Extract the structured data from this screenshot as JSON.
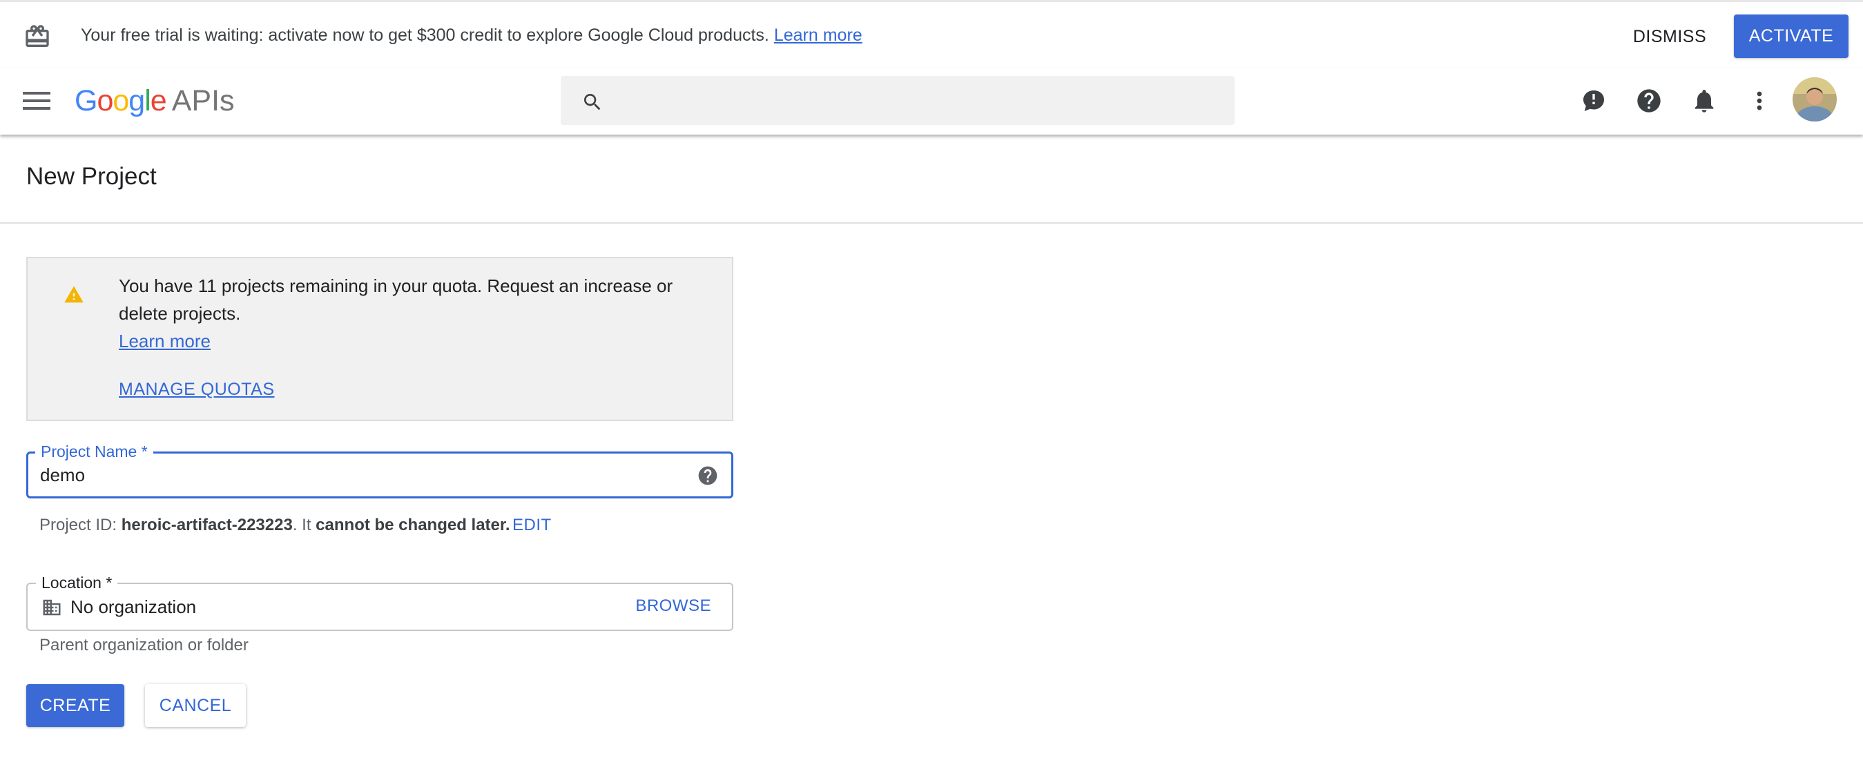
{
  "trial_banner": {
    "message": "Your free trial is waiting: activate now to get $300 credit to explore Google Cloud products.",
    "learn_more": "Learn more",
    "dismiss_label": "DISMISS",
    "activate_label": "ACTIVATE",
    "icon": "gift-icon"
  },
  "header": {
    "logo_letters": [
      "G",
      "o",
      "o",
      "g",
      "l",
      "e"
    ],
    "logo_suffix": "APIs",
    "search_placeholder": "",
    "icons": [
      "menu-icon",
      "search-icon",
      "feedback-icon",
      "help-icon",
      "notifications-icon",
      "more-vert-icon",
      "avatar"
    ]
  },
  "page": {
    "title": "New Project"
  },
  "quota_notice": {
    "message": "You have 11 projects remaining in your quota. Request an increase or delete projects.",
    "learn_more": "Learn more",
    "manage_quotas": "MANAGE QUOTAS",
    "icon": "warning-icon"
  },
  "project_name": {
    "label": "Project Name",
    "required_mark": "*",
    "value": "demo"
  },
  "project_id": {
    "prefix": "Project ID:",
    "id": "heroic-artifact-223223",
    "middle": ". It",
    "emphasis": "cannot be changed later.",
    "edit_label": "EDIT"
  },
  "location": {
    "label": "Location *",
    "value": "No organization",
    "browse_label": "BROWSE",
    "helper": "Parent organization or folder"
  },
  "actions": {
    "create_label": "CREATE",
    "cancel_label": "CANCEL"
  },
  "colors": {
    "primary": "#3b6ad6",
    "link": "#3367d6",
    "warning": "#f4b400",
    "banner_bg": "#ffffff",
    "notice_bg": "#f1f1f1"
  }
}
